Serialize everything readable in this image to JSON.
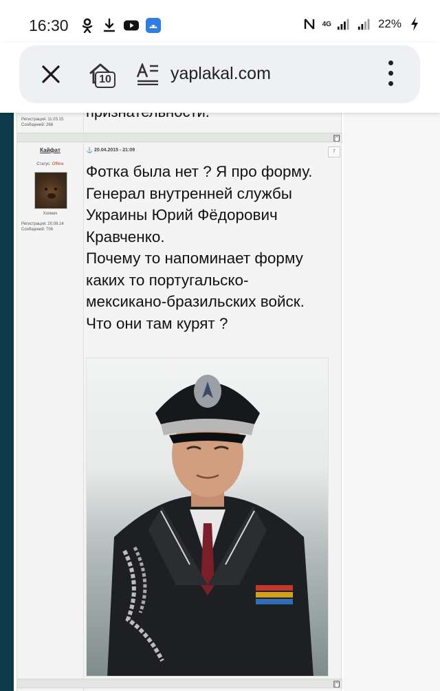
{
  "status_bar": {
    "time": "16:30",
    "battery": "22%",
    "network": "4G",
    "icons": [
      "odnoklassniki-icon",
      "download-icon",
      "youtube-icon",
      "app-icon",
      "nfc-icon",
      "signal-icon",
      "battery-charging-icon"
    ]
  },
  "browser": {
    "url": "yaplakal.com",
    "tab_count": "10"
  },
  "previous_post": {
    "text_fragment": "признательности.",
    "registration": "Регистрация: 11.03.15",
    "messages": "Сообщений: 268"
  },
  "post": {
    "author": "Кайфат",
    "status_label": "Статус: ",
    "status_value": "Offline",
    "avatar_caption": "Хохмач",
    "registration": "Регистрация: 20.08.14",
    "messages": "Сообщений: 706",
    "date": "20.04.2015 - 21:09",
    "number": "7",
    "body_lines": [
      "Фотка была нет ? Я про форму.",
      "Генерал внутренней службы",
      "Украины Юрий Фёдорович",
      "Кравченко.",
      "Почему то напоминает форму",
      "каких то португальско-",
      "мексикано-бразильских войск.",
      "Что они там курят ?"
    ]
  },
  "top_link": "[^]",
  "colors": {
    "left_bar": "#0c3c4a",
    "forum_bg": "#f3f4f3",
    "status_offline": "#c0392b",
    "anchor": "#3a7cc0"
  }
}
